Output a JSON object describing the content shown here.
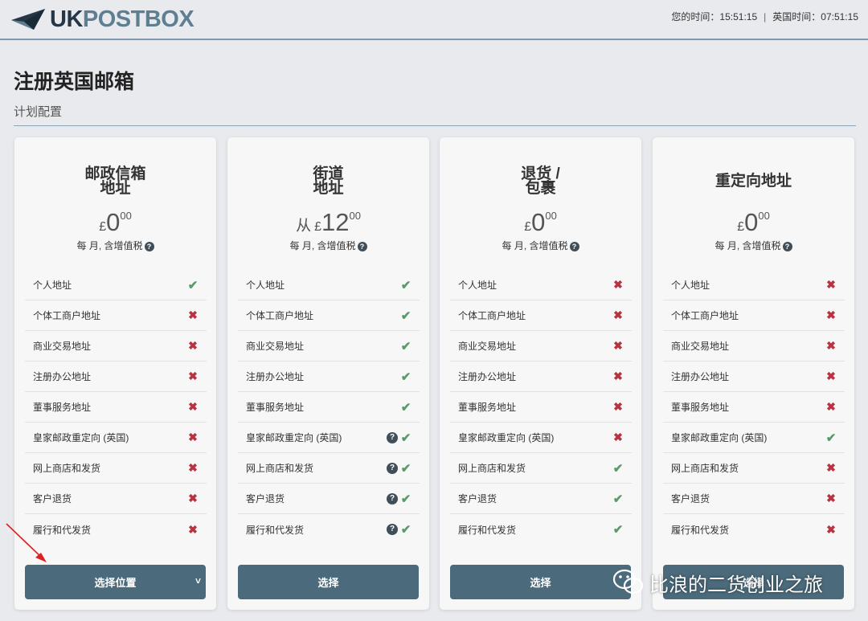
{
  "header": {
    "logo_uk": "UK",
    "logo_post": "POSTBOX",
    "local_time_label": "您的时间：",
    "local_time": "15:51:15",
    "separator": "|",
    "uk_time_label": "英国时间：",
    "uk_time": "07:51:15"
  },
  "page": {
    "title": "注册英国邮箱",
    "subtitle": "计划配置"
  },
  "plans": [
    {
      "title_lines": [
        "邮政信箱",
        "地址"
      ],
      "price_prefix": "",
      "currency": "£",
      "amount": "0",
      "cents": "00",
      "period": "每 月, 含增值税",
      "features": [
        {
          "label": "个人地址",
          "value": "yes",
          "help": false
        },
        {
          "label": "个体工商户地址",
          "value": "no",
          "help": false
        },
        {
          "label": "商业交易地址",
          "value": "no",
          "help": false
        },
        {
          "label": "注册办公地址",
          "value": "no",
          "help": false
        },
        {
          "label": "董事服务地址",
          "value": "no",
          "help": false
        },
        {
          "label": "皇家邮政重定向 (英国)",
          "value": "no",
          "help": false
        },
        {
          "label": "网上商店和发货",
          "value": "no",
          "help": false
        },
        {
          "label": "客户退货",
          "value": "no",
          "help": false
        },
        {
          "label": "履行和代发货",
          "value": "no",
          "help": false
        }
      ],
      "button": "选择位置",
      "button_dropdown": true
    },
    {
      "title_lines": [
        "街道",
        "地址"
      ],
      "price_prefix": "从",
      "currency": "£",
      "amount": "12",
      "cents": "00",
      "period": "每 月, 含增值税",
      "features": [
        {
          "label": "个人地址",
          "value": "yes",
          "help": false
        },
        {
          "label": "个体工商户地址",
          "value": "yes",
          "help": false
        },
        {
          "label": "商业交易地址",
          "value": "yes",
          "help": false
        },
        {
          "label": "注册办公地址",
          "value": "yes",
          "help": false
        },
        {
          "label": "董事服务地址",
          "value": "yes",
          "help": false
        },
        {
          "label": "皇家邮政重定向 (英国)",
          "value": "yes",
          "help": true
        },
        {
          "label": "网上商店和发货",
          "value": "yes",
          "help": true
        },
        {
          "label": "客户退货",
          "value": "yes",
          "help": true
        },
        {
          "label": "履行和代发货",
          "value": "yes",
          "help": true
        }
      ],
      "button": "选择",
      "button_dropdown": false
    },
    {
      "title_lines": [
        "退货 /",
        "包裹"
      ],
      "price_prefix": "",
      "currency": "£",
      "amount": "0",
      "cents": "00",
      "period": "每 月, 含增值税",
      "features": [
        {
          "label": "个人地址",
          "value": "no",
          "help": false
        },
        {
          "label": "个体工商户地址",
          "value": "no",
          "help": false
        },
        {
          "label": "商业交易地址",
          "value": "no",
          "help": false
        },
        {
          "label": "注册办公地址",
          "value": "no",
          "help": false
        },
        {
          "label": "董事服务地址",
          "value": "no",
          "help": false
        },
        {
          "label": "皇家邮政重定向 (英国)",
          "value": "no",
          "help": false
        },
        {
          "label": "网上商店和发货",
          "value": "yes",
          "help": false
        },
        {
          "label": "客户退货",
          "value": "yes",
          "help": false
        },
        {
          "label": "履行和代发货",
          "value": "yes",
          "help": false
        }
      ],
      "button": "选择",
      "button_dropdown": false
    },
    {
      "title_lines": [
        "重定向地址"
      ],
      "price_prefix": "",
      "currency": "£",
      "amount": "0",
      "cents": "00",
      "period": "每 月, 含增值税",
      "features": [
        {
          "label": "个人地址",
          "value": "no",
          "help": false
        },
        {
          "label": "个体工商户地址",
          "value": "no",
          "help": false
        },
        {
          "label": "商业交易地址",
          "value": "no",
          "help": false
        },
        {
          "label": "注册办公地址",
          "value": "no",
          "help": false
        },
        {
          "label": "董事服务地址",
          "value": "no",
          "help": false
        },
        {
          "label": "皇家邮政重定向 (英国)",
          "value": "yes",
          "help": false
        },
        {
          "label": "网上商店和发货",
          "value": "no",
          "help": false
        },
        {
          "label": "客户退货",
          "value": "no",
          "help": false
        },
        {
          "label": "履行和代发货",
          "value": "no",
          "help": false
        }
      ],
      "button": "选择",
      "button_dropdown": false
    }
  ],
  "icons": {
    "check": "checkmark-icon",
    "cross": "cross-icon",
    "help": "question-circle-icon",
    "caret": "chevron-down-icon"
  },
  "watermark": {
    "text": "比浪的二货创业之旅"
  },
  "colors": {
    "button": "#4b6a7b",
    "check": "#5a9a6a",
    "cross": "#b8323f",
    "logo_dark": "#253746",
    "logo_light": "#5e7e91"
  }
}
